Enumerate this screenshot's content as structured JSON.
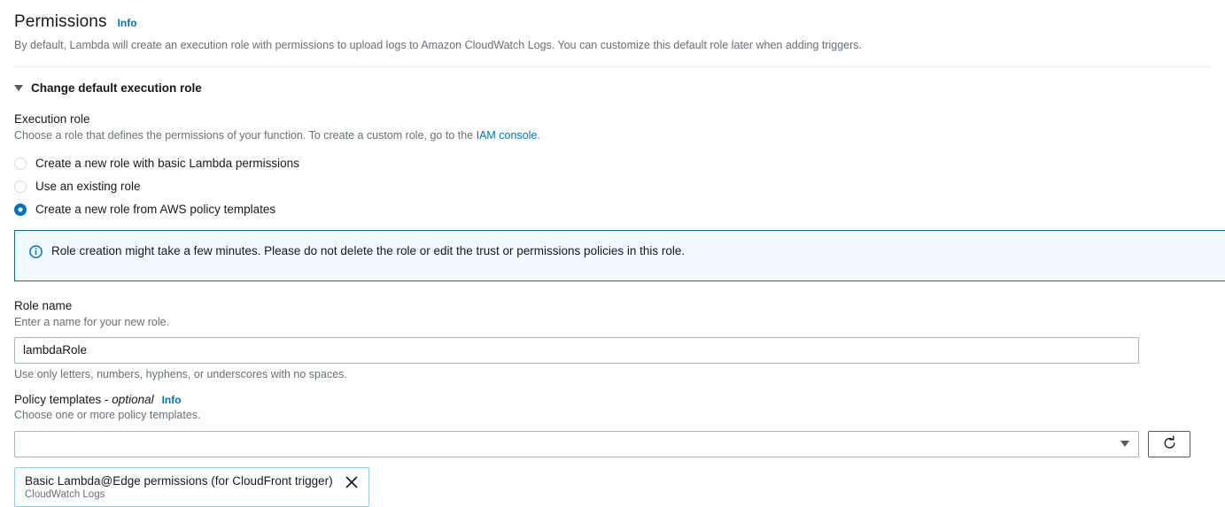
{
  "section": {
    "title": "Permissions",
    "info_label": "Info",
    "description": "By default, Lambda will create an execution role with permissions to upload logs to Amazon CloudWatch Logs. You can customize this default role later when adding triggers."
  },
  "expandable": {
    "label": "Change default execution role",
    "expanded": true,
    "caret_icon": "caret-down-icon"
  },
  "execution_role": {
    "label": "Execution role",
    "description_before_link": "Choose a role that defines the permissions of your function. To create a custom role, go to the ",
    "link_text": "IAM console",
    "description_after_link": ".",
    "options": [
      {
        "label": "Create a new role with basic Lambda permissions",
        "selected": false
      },
      {
        "label": "Use an existing role",
        "selected": false
      },
      {
        "label": "Create a new role from AWS policy templates",
        "selected": true
      }
    ]
  },
  "alert": {
    "icon": "info-circle-icon",
    "text": "Role creation might take a few minutes. Please do not delete the role or edit the trust or permissions policies in this role.",
    "border_color": "#0f6f8a",
    "background_color": "#f1faff"
  },
  "role_name": {
    "label": "Role name",
    "description": "Enter a name for your new role.",
    "value": "lambdaRole",
    "placeholder": "",
    "helper_text": "Use only letters, numbers, hyphens, or underscores with no spaces."
  },
  "policy_templates": {
    "label": "Policy templates - ",
    "optional_text": "optional",
    "info_label": "Info",
    "description": "Choose one or more policy templates.",
    "select_value": "",
    "select_placeholder": "",
    "select_caret_icon": "caret-down-icon",
    "refresh_icon": "refresh-icon",
    "selected_tokens": [
      {
        "title": "Basic Lambda@Edge permissions (for CloudFront trigger)",
        "subtitle": "CloudWatch Logs",
        "dismiss_icon": "close-icon"
      }
    ]
  },
  "colors": {
    "link": "#0073bb",
    "accent": "#0073bb",
    "text": "#16191f",
    "muted": "#687078",
    "token_border": "#95d1dd"
  }
}
